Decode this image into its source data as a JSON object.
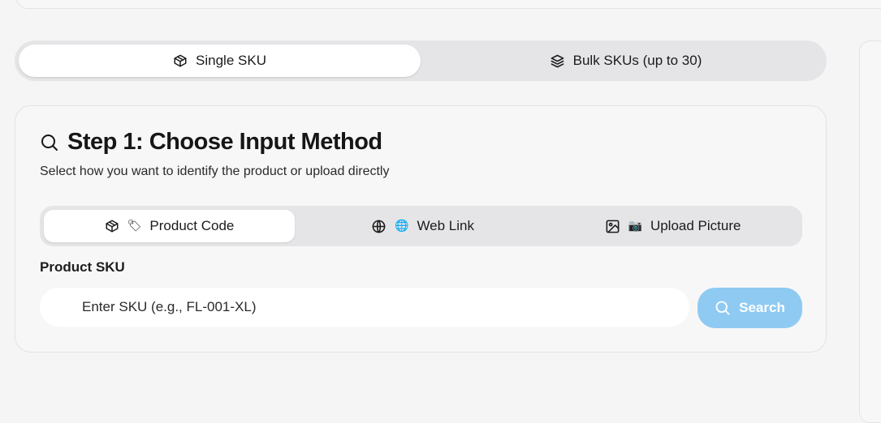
{
  "mode_tabs": [
    {
      "label": "Single SKU",
      "icon": "package-icon",
      "active": true
    },
    {
      "label": "Bulk SKUs (up to 30)",
      "icon": "layers-icon",
      "active": false
    }
  ],
  "step": {
    "title": "Step 1: Choose Input Method",
    "subtitle": "Select how you want to identify the product or upload directly",
    "icon": "search-icon"
  },
  "method_tabs": [
    {
      "label": "Product Code",
      "icon": "package-icon",
      "emoji": "🏷",
      "active": true
    },
    {
      "label": "Web Link",
      "icon": "globe-icon",
      "emoji": "🌐",
      "active": false
    },
    {
      "label": "Upload Picture",
      "icon": "image-icon",
      "emoji": "📷",
      "active": false
    }
  ],
  "sku": {
    "label": "Product SKU",
    "placeholder": "Enter SKU (e.g., FL-001-XL)",
    "value": ""
  },
  "search_button": {
    "label": "Search",
    "icon": "search-icon"
  },
  "colors": {
    "accent_button": "#8fcaf3",
    "background": "#f5f5f6",
    "tab_track": "#e5e5e7"
  }
}
